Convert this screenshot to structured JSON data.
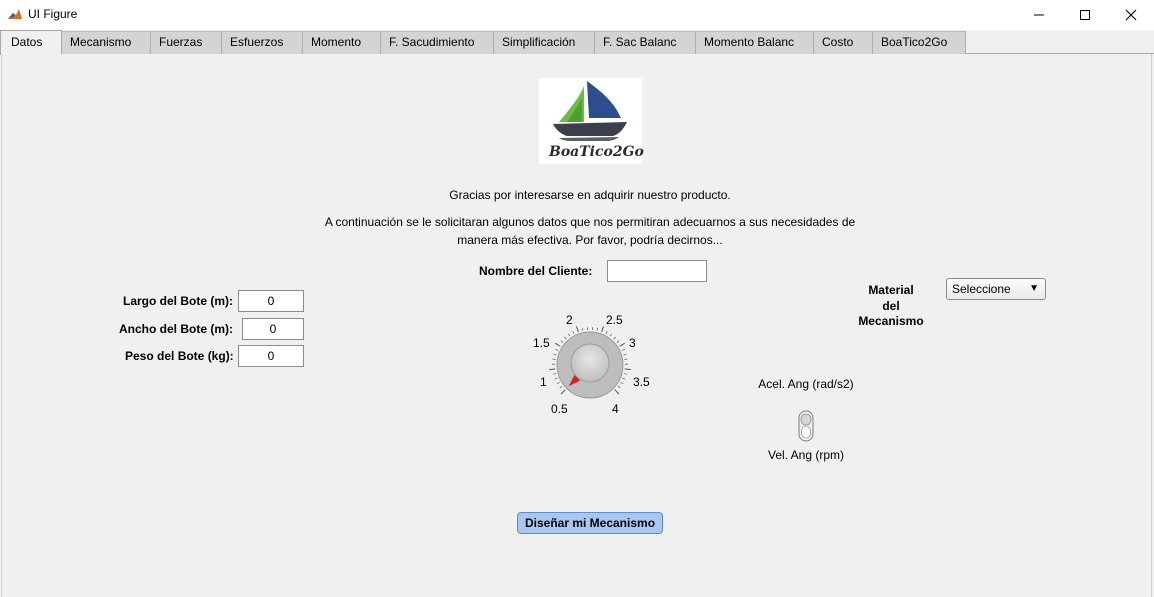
{
  "window": {
    "title": "UI Figure",
    "minimize_icon": "minimize-icon",
    "maximize_icon": "maximize-icon",
    "close_icon": "close-icon"
  },
  "tabs": [
    {
      "label": "Datos",
      "active": true
    },
    {
      "label": "Mecanismo"
    },
    {
      "label": "Fuerzas"
    },
    {
      "label": "Esfuerzos"
    },
    {
      "label": "Momento"
    },
    {
      "label": "F. Sacudimiento"
    },
    {
      "label": "Simplificación"
    },
    {
      "label": "F. Sac Balanc"
    },
    {
      "label": "Momento Balanc"
    },
    {
      "label": "Costo"
    },
    {
      "label": "BoaTico2Go"
    }
  ],
  "logo": {
    "text": "BoaTico2Go",
    "colors": {
      "sail_blue": "#2d4e8c",
      "sail_green": "#6cbf3d",
      "hull": "#3a3f4a"
    }
  },
  "intro": {
    "line1": "Gracias por interesarse en adquirir nuestro producto.",
    "line2": "A continuación se le solicitaran algunos datos que nos permitiran adecuarnos a sus necesidades de",
    "line3": "manera más efectiva. Por favor, podría decirnos..."
  },
  "client": {
    "label": "Nombre del Cliente:",
    "value": ""
  },
  "boat": {
    "largo_label": "Largo del Bote (m):",
    "largo_value": "0",
    "ancho_label": "Ancho del Bote (m):",
    "ancho_value": "0",
    "peso_label": "Peso del Bote (kg):",
    "peso_value": "0"
  },
  "knob": {
    "tick_labels": [
      "0.5",
      "1",
      "1.5",
      "2",
      "2.5",
      "3",
      "3.5",
      "4"
    ],
    "value": 0.5,
    "min": 0.5,
    "max": 4
  },
  "material": {
    "label_line1": "Material",
    "label_line2": "del",
    "label_line3": "Mecanismo",
    "selected": "Seleccione"
  },
  "switch": {
    "top_label": "Acel. Ang (rad/s2)",
    "bottom_label": "Vel. Ang (rpm)",
    "state": "bottom"
  },
  "design_button": {
    "label": "Diseñar mi Mecanismo",
    "color": "#a7c7f1"
  }
}
